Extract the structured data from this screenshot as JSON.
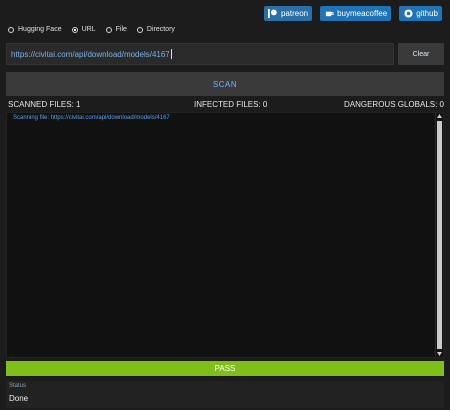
{
  "topbar": {
    "patreon_label": "patreon",
    "buymeacoffee_label": "buymeacoffee",
    "github_label": "github"
  },
  "source_options": {
    "items": [
      {
        "label": "Hugging Face",
        "selected": false
      },
      {
        "label": "URL",
        "selected": true
      },
      {
        "label": "File",
        "selected": false
      },
      {
        "label": "Directory",
        "selected": false
      }
    ]
  },
  "url_input": {
    "value": "https://civitai.com/api/download/models/4167"
  },
  "clear_label": "Clear",
  "scan_label": "SCAN",
  "stats": {
    "scanned": "SCANNED FILES:  1",
    "infected": "INFECTED FILES:  0",
    "dangerous": "DANGEROUS GLOBALS:  0"
  },
  "log": {
    "lines": [
      "Scanning file:  https://civitai.com/api/download/models/4167"
    ]
  },
  "result_label": "PASS",
  "status": {
    "label": "Status",
    "value": "Done"
  },
  "colors": {
    "pass": "#7fbf1a",
    "accent": "#1f73b7",
    "link_text": "#5aa0e8"
  }
}
